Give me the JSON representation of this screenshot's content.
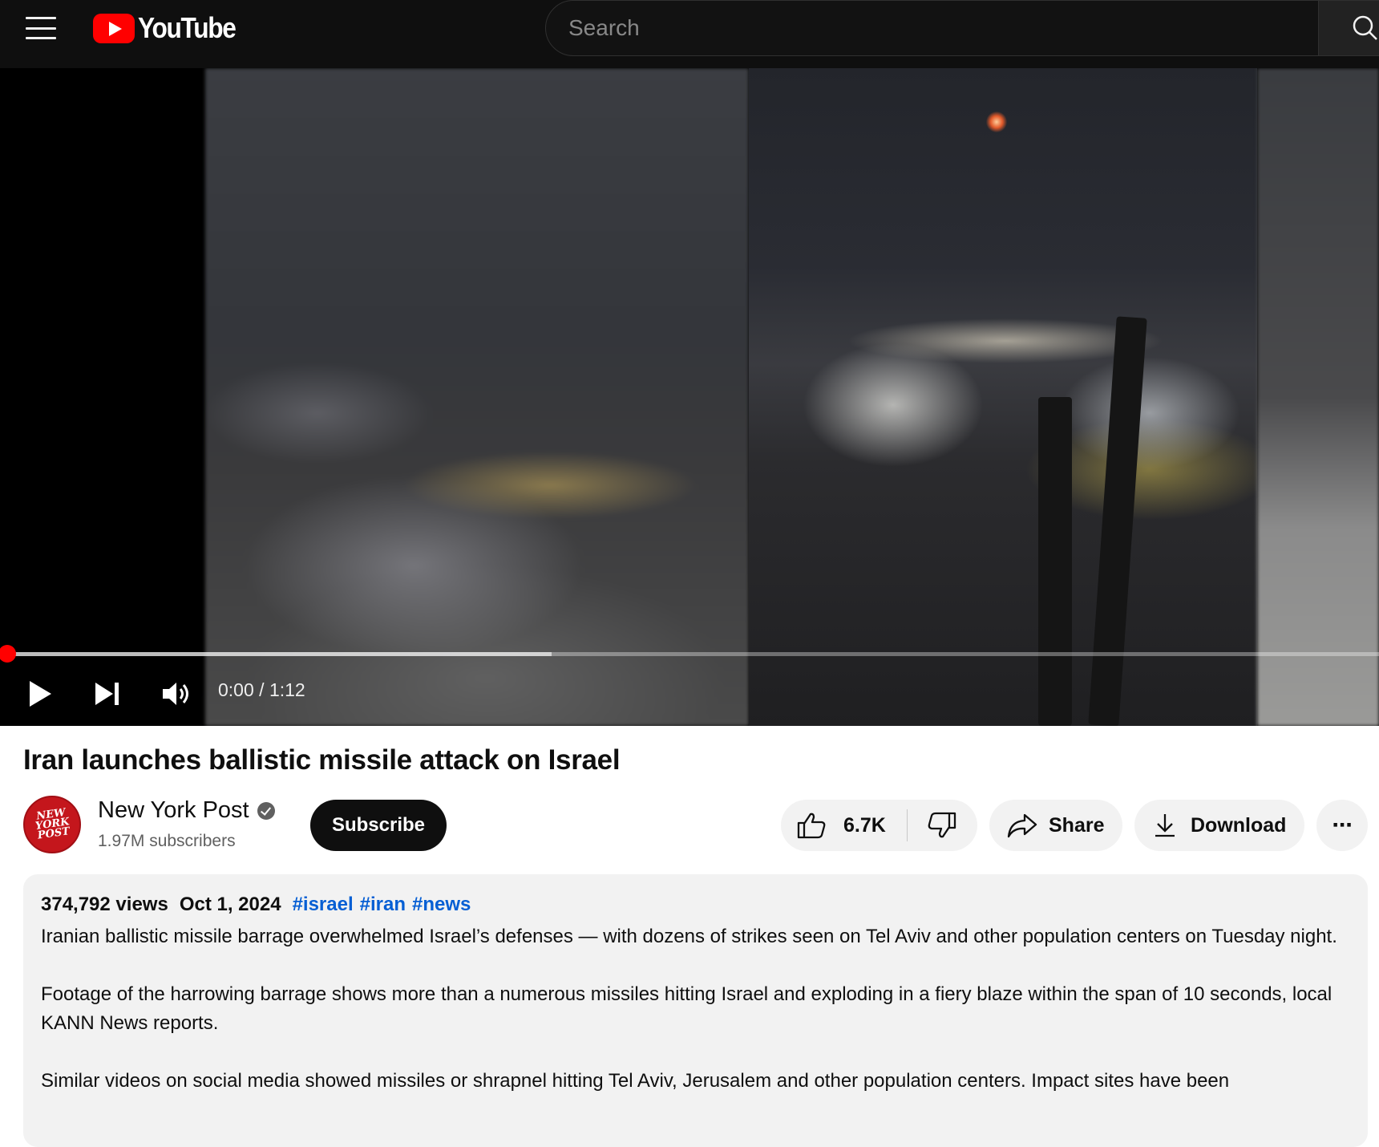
{
  "header": {
    "logo_text": "YouTube",
    "search_placeholder": "Search"
  },
  "player": {
    "time_current": "0:00",
    "time_separator": "/",
    "time_total": "1:12",
    "progress_played_fraction": 0.0,
    "progress_buffered_fraction": 0.4,
    "controls": [
      "play-icon",
      "next-icon",
      "volume-icon"
    ]
  },
  "video": {
    "title": "Iran launches ballistic missile attack on Israel"
  },
  "channel": {
    "name": "New York Post",
    "subscribers": "1.97M subscribers",
    "avatar_text": "NEW YORK POST",
    "subscribe_label": "Subscribe"
  },
  "actions": {
    "likes": "6.7K",
    "share_label": "Share",
    "download_label": "Download",
    "more_label": "⋯"
  },
  "description": {
    "views": "374,792 views",
    "date": "Oct 1, 2024",
    "hashtags": [
      "#israel",
      "#iran",
      "#news"
    ],
    "paragraphs": [
      "Iranian ballistic missile barrage overwhelmed Israel’s defenses — with dozens of strikes seen on Tel Aviv and other population centers on Tuesday night.",
      "Footage of the harrowing barrage shows more than a numerous missiles hitting Israel and exploding in a fiery blaze within the span of 10 seconds, local KANN News reports.",
      "Similar videos on social media showed missiles or shrapnel hitting Tel Aviv, Jerusalem and other population centers. Impact sites have been"
    ]
  },
  "colors": {
    "brand_red": "#ff0000",
    "link_blue": "#065fd4",
    "topbar_bg": "#0f0f0f"
  }
}
